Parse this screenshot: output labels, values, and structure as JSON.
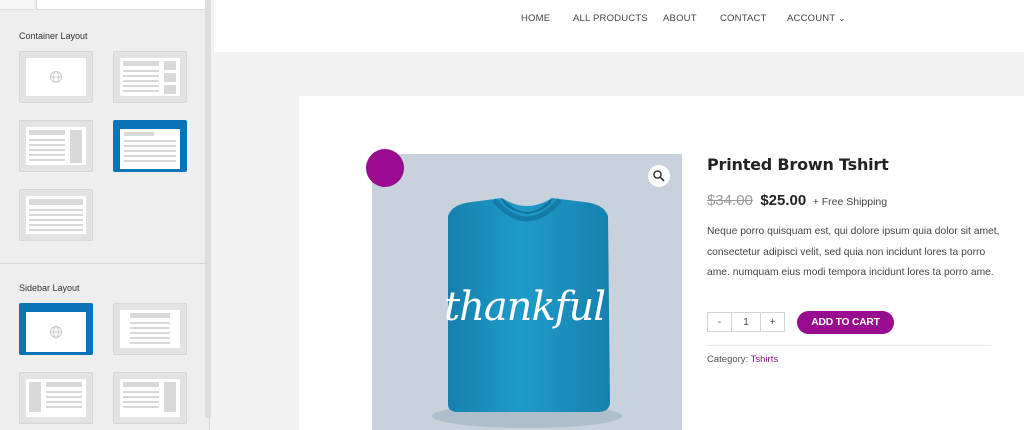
{
  "sidebar": {
    "container_layout_title": "Container Layout",
    "sidebar_layout_title": "Sidebar Layout",
    "container_options": [
      {
        "name": "full-width",
        "selected": false
      },
      {
        "name": "boxed-right-sidebar",
        "selected": false
      },
      {
        "name": "boxed-both-sidebars",
        "selected": false
      },
      {
        "name": "boxed-content",
        "selected": true
      },
      {
        "name": "plain-content",
        "selected": false
      }
    ],
    "sidebar_options": [
      {
        "name": "default",
        "selected": true
      },
      {
        "name": "no-sidebar",
        "selected": false
      },
      {
        "name": "left-sidebar",
        "selected": false
      },
      {
        "name": "right-sidebar",
        "selected": false
      }
    ],
    "selected_color": "#0b73b8"
  },
  "nav": {
    "home": "HOME",
    "products": "ALL PRODUCTS",
    "about": "ABOUT",
    "contact": "CONTACT",
    "account": "ACCOUNT"
  },
  "product": {
    "title": "Printed Brown Tshirt",
    "old_price": "$34.00",
    "new_price": "$25.00",
    "shipping": "+ Free Shipping",
    "description": "Neque porro quisquam est, qui dolore ipsum quia dolor sit amet, consectetur adipisci velit, sed quia non incidunt lores ta porro ame. numquam eius modi tempora incidunt lores ta porro ame.",
    "image_text": "thankful",
    "quantity": "1",
    "qty_minus": "-",
    "qty_plus": "+",
    "add_to_cart": "ADD TO CART",
    "category_label": "Category:",
    "category_value": "Tshirts"
  },
  "colors": {
    "brand": "#980b8f",
    "shirt": "#1b92c0",
    "image_bg": "#c7d2dc"
  },
  "icons": {
    "zoom": "magnifier-icon",
    "layout_preview": "globe-icon",
    "account_dropdown": "chevron-down-icon"
  }
}
